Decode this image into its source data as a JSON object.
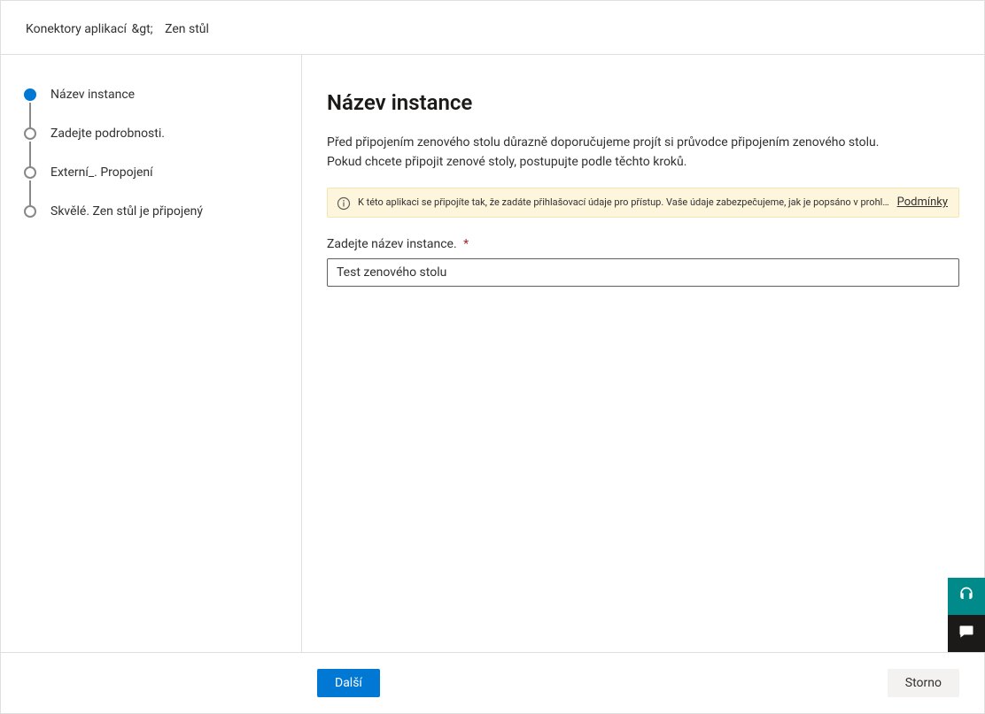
{
  "breadcrumb": {
    "root": "Konektory aplikací",
    "sep": "&gt;",
    "current": "Zen stůl"
  },
  "stepper": {
    "items": [
      {
        "label": "Název instance",
        "active": true
      },
      {
        "label": "Zadejte podrobnosti.",
        "active": false
      },
      {
        "label": "Externí_. Propojení",
        "active": false
      },
      {
        "label": "Skvělé. Zen stůl je připojený",
        "active": false
      }
    ]
  },
  "main": {
    "title": "Název instance",
    "description_line1": "Před připojením zenového stolu důrazně doporučujeme projít si průvodce připojením zenového stolu.",
    "description_line2": "Pokud chcete připojit zenové stoly, postupujte podle těchto kroků.",
    "banner": {
      "text": "K této aplikaci se připojíte tak, že zadáte přihlašovací údaje pro přístup. Vaše údaje zabezpečujeme, jak je popsáno v prohlášení o zásadách ochrany osobních údajů !",
      "link": "Podmínky"
    },
    "field": {
      "label": "Zadejte název instance.",
      "required_marker": "*",
      "value": "Test zenového stolu"
    }
  },
  "footer": {
    "primary": "Další",
    "secondary": "Storno"
  }
}
